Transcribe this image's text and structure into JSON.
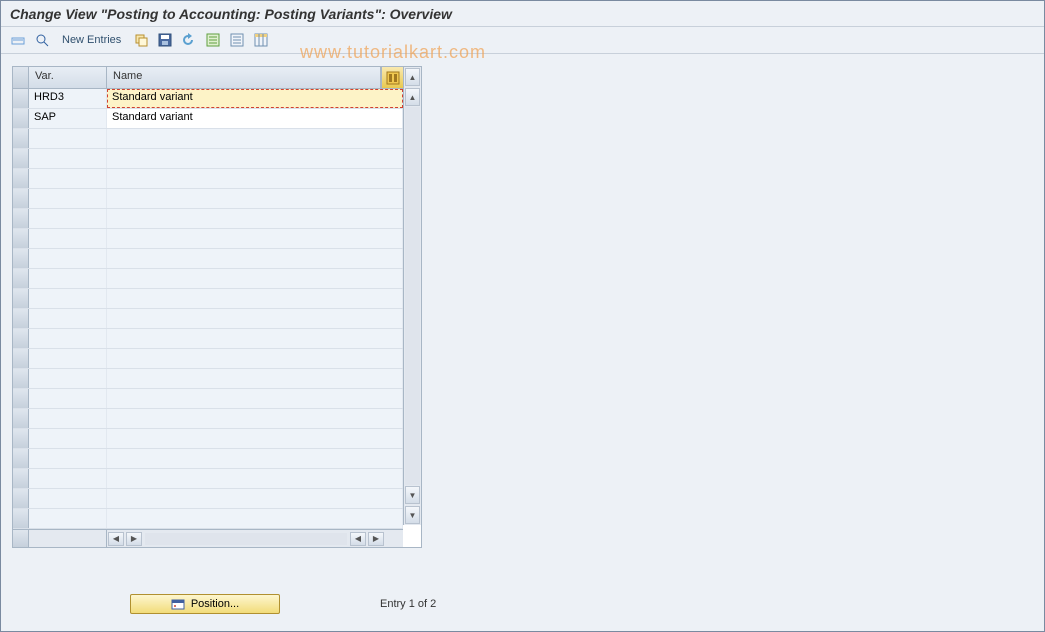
{
  "title": "Change View \"Posting to Accounting: Posting Variants\": Overview",
  "toolbar": {
    "new_entries_label": "New Entries"
  },
  "watermark": "www.tutorialkart.com",
  "table": {
    "columns": {
      "var": "Var.",
      "name": "Name"
    },
    "rows": [
      {
        "var": "HRD3",
        "name": "Standard variant",
        "selected": true
      },
      {
        "var": "SAP",
        "name": "Standard variant",
        "selected": false
      }
    ],
    "empty_rows": 20
  },
  "footer": {
    "position_label": "Position...",
    "entry_text": "Entry 1 of 2"
  }
}
